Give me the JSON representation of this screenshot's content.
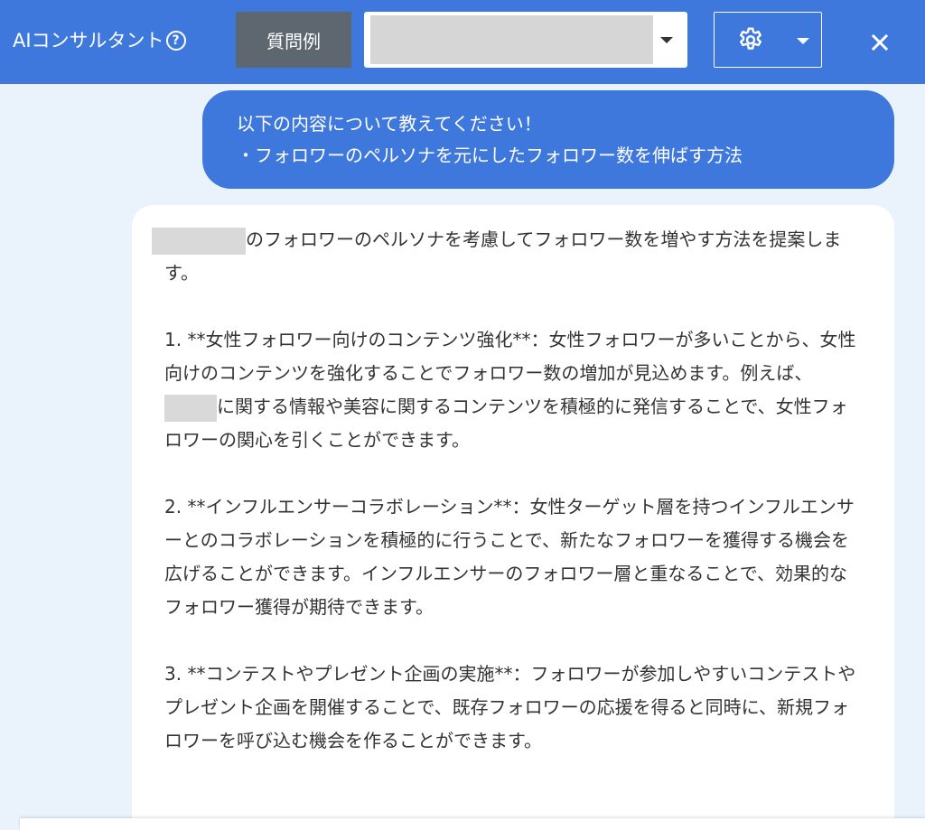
{
  "header": {
    "title": "AIコンサルタント",
    "help_icon_glyph": "?",
    "examples_button": "質問例",
    "template_select": {
      "value": ""
    },
    "settings_icon": "gear-icon",
    "close_icon": "close-icon",
    "accent_color": "#3f78dc"
  },
  "user_message": {
    "lines": [
      "以下の内容について教えてください！",
      "・フォロワーのペルソナを元にしたフォロワー数を伸ばす方法"
    ]
  },
  "assistant_message": {
    "intro_after_redaction": "のフォロワーのペルソナを考慮してフォロワー数を増やす方法を提案します。",
    "item1_before_redaction": "1. **女性フォロワー向けのコンテンツ強化**：女性フォロワーが多いことから、女性向けのコンテンツを強化することでフォロワー数の増加が見込めます。例えば、",
    "item1_after_redaction": "に関する情報や美容に関するコンテンツを積極的に発信することで、女性フォロワーの関心を引くことができます。",
    "item2": "2. **インフルエンサーコラボレーション**：女性ターゲット層を持つインフルエンサーとのコラボレーションを積極的に行うことで、新たなフォロワーを獲得する機会を広げることができます。インフルエンサーのフォロワー層と重なることで、効果的なフォロワー獲得が期待できます。",
    "item3": "3. **コンテストやプレゼント企画の実施**：フォロワーが参加しやすいコンテストやプレゼント企画を開催することで、既存フォロワーの応援を得ると同時に、新規フォロワーを呼び込む機会を作ることができます。"
  }
}
